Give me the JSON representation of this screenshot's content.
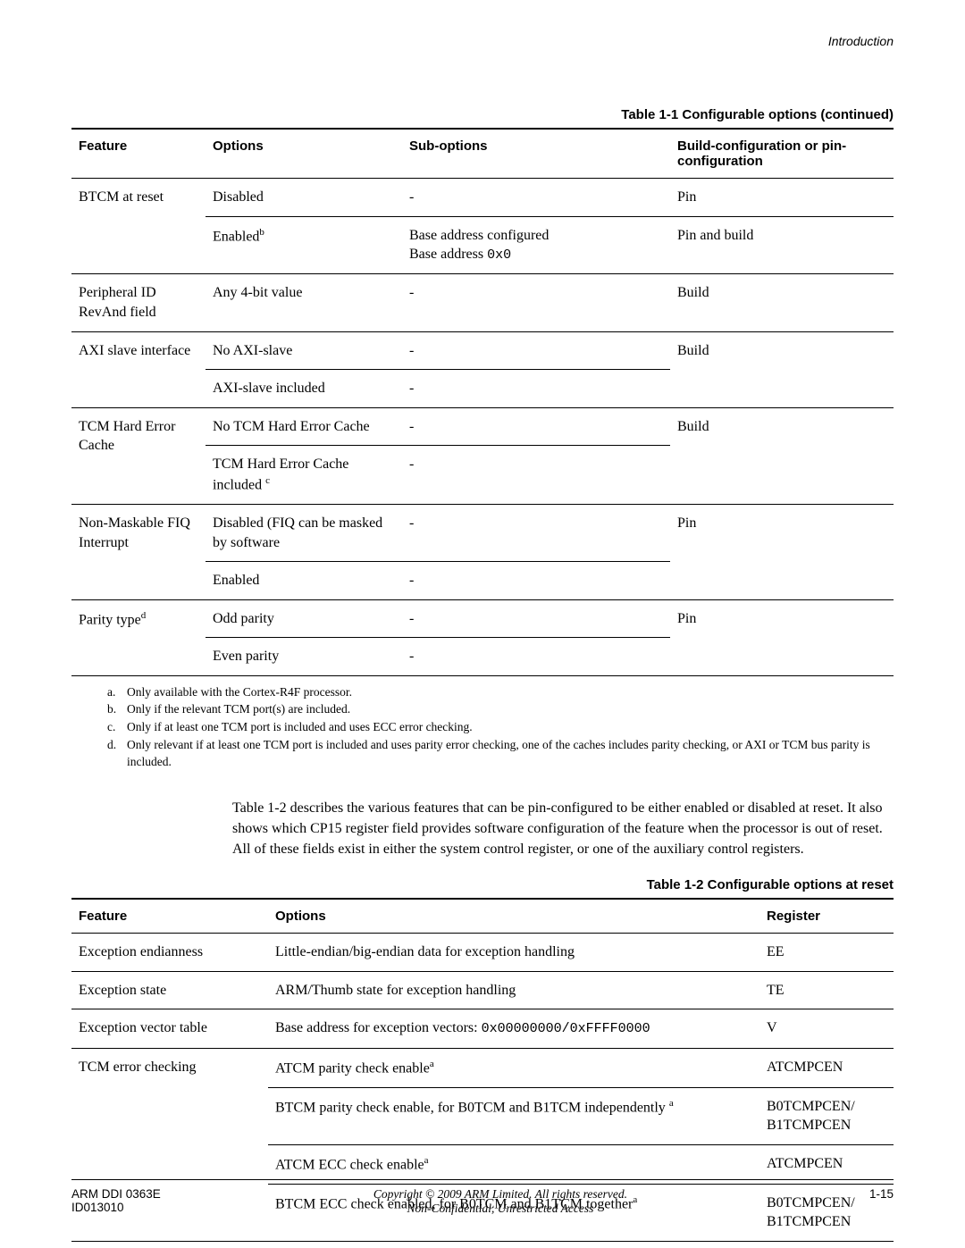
{
  "header": {
    "section": "Introduction"
  },
  "table1": {
    "caption": "Table 1-1 Configurable options (continued)",
    "headers": {
      "feature": "Feature",
      "options": "Options",
      "subopts": "Sub-options",
      "build": "Build-configuration or pin-configuration"
    },
    "rows": {
      "r1": {
        "feature": "BTCM at reset",
        "opt1": "Disabled",
        "sub1": "-",
        "build1": "Pin",
        "opt2a": "Enabled",
        "opt2b_sup": "b",
        "sub2a": "Base address configured",
        "sub2b": "Base address ",
        "sub2b_mono": "0x0",
        "build2": "Pin and build"
      },
      "r2": {
        "feature": "Peripheral ID RevAnd field",
        "opt": "Any 4-bit value",
        "sub": "-",
        "build": "Build"
      },
      "r3": {
        "feature": "AXI slave interface",
        "opt1": "No AXI-slave",
        "sub1": "-",
        "build": "Build",
        "opt2": "AXI-slave included",
        "sub2": "-"
      },
      "r4": {
        "feature": "TCM Hard Error Cache",
        "opt1": "No TCM Hard Error Cache",
        "sub1": "-",
        "build": "Build",
        "opt2a": "TCM Hard Error Cache included ",
        "opt2b_sup": "c",
        "sub2": "-"
      },
      "r5": {
        "feature": "Non-Maskable FIQ Interrupt",
        "opt1": "Disabled (FIQ can be masked by software",
        "sub1": "-",
        "build": "Pin",
        "opt2": "Enabled",
        "sub2": "-"
      },
      "r6": {
        "feature_a": "Parity type",
        "feature_b_sup": "d",
        "opt1": "Odd parity",
        "sub1": "-",
        "build": "Pin",
        "opt2": "Even parity",
        "sub2": "-"
      }
    },
    "footnotes": {
      "a": "Only available with the Cortex-R4F processor.",
      "b": "Only if the relevant TCM port(s) are included.",
      "c": "Only if at least one TCM port is included and uses ECC error checking.",
      "d": "Only relevant if at least one TCM port is included and uses parity error checking, one of the caches includes parity checking, or AXI or TCM bus parity is included."
    }
  },
  "paragraph": "Table 1-2 describes the various features that can be pin-configured to be either enabled or disabled at reset. It also shows which CP15 register field provides software configuration of the feature when the processor is out of reset. All of these fields exist in either the system control register, or one of the auxiliary control registers.",
  "table2": {
    "caption": "Table 1-2 Configurable options at reset",
    "headers": {
      "feature": "Feature",
      "options": "Options",
      "register": "Register"
    },
    "rows": {
      "r1": {
        "feature": "Exception endianness",
        "opt": "Little-endian/big-endian data for exception handling",
        "reg": "EE"
      },
      "r2": {
        "feature": "Exception state",
        "opt": "ARM/Thumb state for exception handling",
        "reg": "TE"
      },
      "r3": {
        "feature": "Exception vector table",
        "opt_a": "Base address for exception vectors: ",
        "opt_b_mono": "0x00000000/0xFFFF0000",
        "reg": "V"
      },
      "r4": {
        "feature": "TCM error checking",
        "opt1a": "ATCM parity check enable",
        "opt1b_sup": "a",
        "reg1": "ATCMPCEN",
        "opt2a": "BTCM parity check enable, for B0TCM and B1TCM independently ",
        "opt2b_sup": "a",
        "reg2": "B0TCMPCEN/ B1TCMPCEN",
        "opt3a": "ATCM ECC check enable",
        "opt3b_sup": "a",
        "reg3": "ATCMPCEN",
        "opt4a": "BTCM ECC check enabled, for B0TCM and B1TCM together",
        "opt4b_sup": "a",
        "reg4": "B0TCMPCEN/ B1TCMPCEN"
      }
    }
  },
  "footer": {
    "left1": "ARM DDI 0363E",
    "left2": "ID013010",
    "center1": "Copyright © 2009 ARM Limited. All rights reserved.",
    "center2": "Non-Confidential, Unrestricted Access",
    "right": "1-15"
  },
  "labels": {
    "a": "a.",
    "b": "b.",
    "c": "c.",
    "d": "d."
  }
}
